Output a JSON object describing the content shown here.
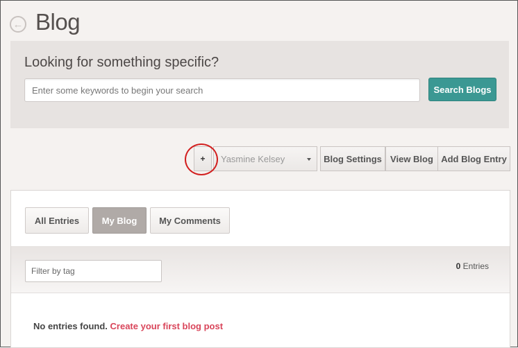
{
  "header": {
    "title": "Blog",
    "back_icon": "arrow-left-circle-icon"
  },
  "search": {
    "heading": "Looking for something specific?",
    "placeholder": "Enter some keywords to begin your search",
    "value": "",
    "button_label": "Search Blogs",
    "button_color": "#3b9893"
  },
  "toolbar": {
    "plus_label": "+",
    "user_select": "Yasmine Kelsey",
    "blog_settings_label": "Blog Settings",
    "view_blog_label": "View Blog",
    "add_entry_label": "Add Blog Entry",
    "highlight_color": "#d21f1f"
  },
  "tabs": [
    {
      "label": "All Entries",
      "selected": false
    },
    {
      "label": "My Blog",
      "selected": true
    },
    {
      "label": "My Comments",
      "selected": false
    }
  ],
  "filter": {
    "placeholder": "Filter by tag",
    "value": "",
    "count": "0",
    "count_suffix": " Entries"
  },
  "empty_state": {
    "message": "No entries found.",
    "link_text": "Create your first blog post",
    "link_color": "#d9455a"
  }
}
